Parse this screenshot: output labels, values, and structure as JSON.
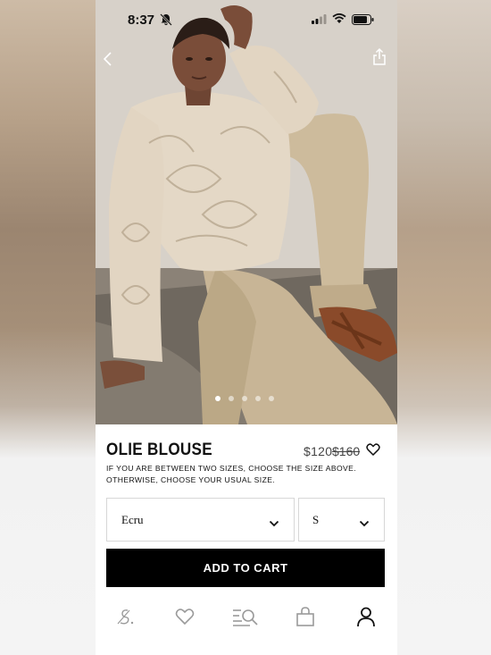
{
  "status": {
    "time": "8:37"
  },
  "product": {
    "name": "OLIE BLOUSE",
    "price": "$120",
    "original_price": "$160",
    "size_hint": "IF YOU ARE BETWEEN TWO SIZES, CHOOSE THE SIZE ABOVE. OTHERWISE, CHOOSE YOUR USUAL SIZE."
  },
  "selectors": {
    "color": "Ecru",
    "size": "S"
  },
  "actions": {
    "add_to_cart": "ADD TO CART"
  },
  "gallery": {
    "image_count": 5,
    "active_index": 0
  },
  "tabbar": {
    "items": [
      "brand-logo-icon",
      "heart-icon",
      "search-filter-icon",
      "bag-icon",
      "user-icon"
    ],
    "active": "user-icon"
  },
  "colors": {
    "accent": "#000000",
    "text": "#111111",
    "border": "#d7d7d7"
  }
}
